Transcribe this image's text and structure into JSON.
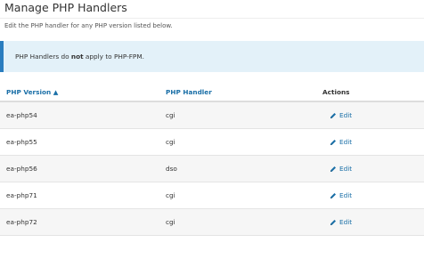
{
  "page": {
    "title": "Manage PHP Handlers",
    "description": "Edit the PHP handler for any PHP version listed below."
  },
  "notice": {
    "prefix": "PHP Handlers do ",
    "emphasis": "not",
    "suffix": " apply to PHP-FPM."
  },
  "table": {
    "headers": {
      "version": "PHP Version ▲",
      "handler": "PHP Handler",
      "actions": "Actions"
    },
    "rows": [
      {
        "version": "ea-php54",
        "handler": "cgi",
        "action": "Edit"
      },
      {
        "version": "ea-php55",
        "handler": "cgi",
        "action": "Edit"
      },
      {
        "version": "ea-php56",
        "handler": "dso",
        "action": "Edit"
      },
      {
        "version": "ea-php71",
        "handler": "cgi",
        "action": "Edit"
      },
      {
        "version": "ea-php72",
        "handler": "cgi",
        "action": "Edit"
      }
    ],
    "action_icon": "pencil-icon"
  },
  "colors": {
    "link": "#1a6fa7",
    "notice_background": "#e3f1f9",
    "notice_border": "#2a7dbf",
    "row_stripe": "#f6f6f6"
  }
}
